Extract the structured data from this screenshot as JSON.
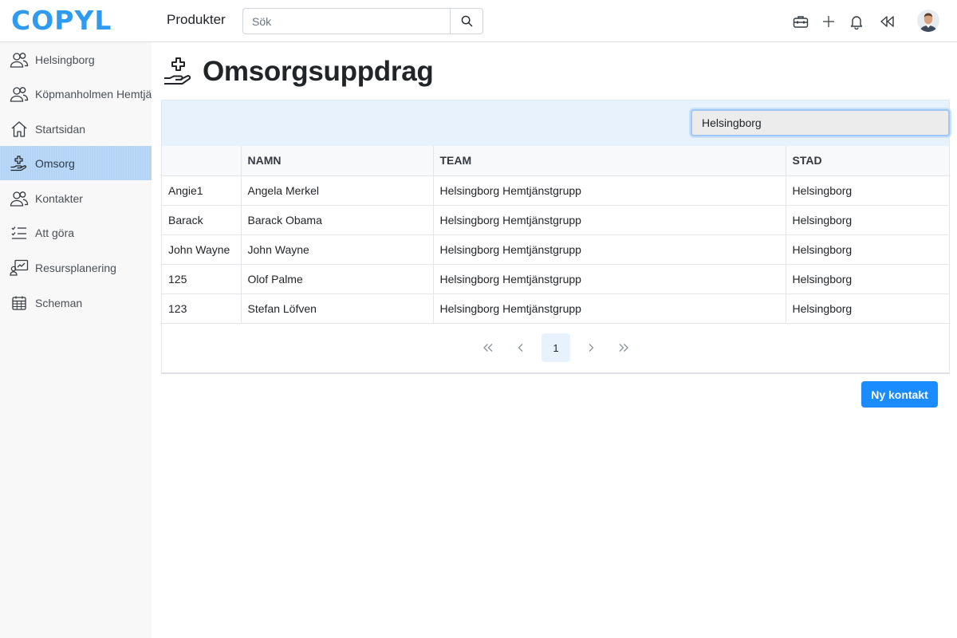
{
  "header": {
    "logo_text": "COPYL",
    "nav_title": "Produkter",
    "search": {
      "placeholder": "Sök",
      "value": ""
    },
    "icons": [
      "toolbox-icon",
      "plus-icon",
      "bell-icon",
      "rewind-icon"
    ]
  },
  "sidebar": {
    "items": [
      {
        "label": "Helsingborg",
        "icon": "users-icon",
        "active": false
      },
      {
        "label": "Köpmanholmen Hemtjänst",
        "icon": "users-icon",
        "active": false
      },
      {
        "label": "Startsidan",
        "icon": "home-icon",
        "active": false
      },
      {
        "label": "Omsorg",
        "icon": "hand-care-icon",
        "active": true
      },
      {
        "label": "Kontakter",
        "icon": "users-icon",
        "active": false
      },
      {
        "label": "Att göra",
        "icon": "checklist-icon",
        "active": false
      },
      {
        "label": "Resursplanering",
        "icon": "resource-icon",
        "active": false
      },
      {
        "label": "Scheman",
        "icon": "calendar-icon",
        "active": false
      }
    ]
  },
  "main": {
    "title": "Omsorgsuppdrag",
    "filter_value": "Helsingborg",
    "table": {
      "columns": [
        "",
        "NAMN",
        "TEAM",
        "STAD"
      ],
      "rows": [
        [
          "Angie1",
          "Angela Merkel",
          "Helsingborg Hemtjänstgrupp",
          "Helsingborg"
        ],
        [
          "Barack",
          "Barack Obama",
          "Helsingborg Hemtjänstgrupp",
          "Helsingborg"
        ],
        [
          "John Wayne",
          "John Wayne",
          "Helsingborg Hemtjänstgrupp",
          "Helsingborg"
        ],
        [
          "125",
          "Olof Palme",
          "Helsingborg Hemtjänstgrupp",
          "Helsingborg"
        ],
        [
          "123",
          "Stefan Löfven",
          "Helsingborg Hemtjänstgrupp",
          "Helsingborg"
        ]
      ]
    },
    "pagination": {
      "first": "«",
      "prev": "‹",
      "current": "1",
      "next": "›",
      "last": "»"
    },
    "new_button_label": "Ny kontakt"
  },
  "colors": {
    "accent": "#1a8cff",
    "logo": "#2f9bf0",
    "active_sidebar": "#b3d4f7",
    "filter_bar": "#e8f2fd"
  }
}
